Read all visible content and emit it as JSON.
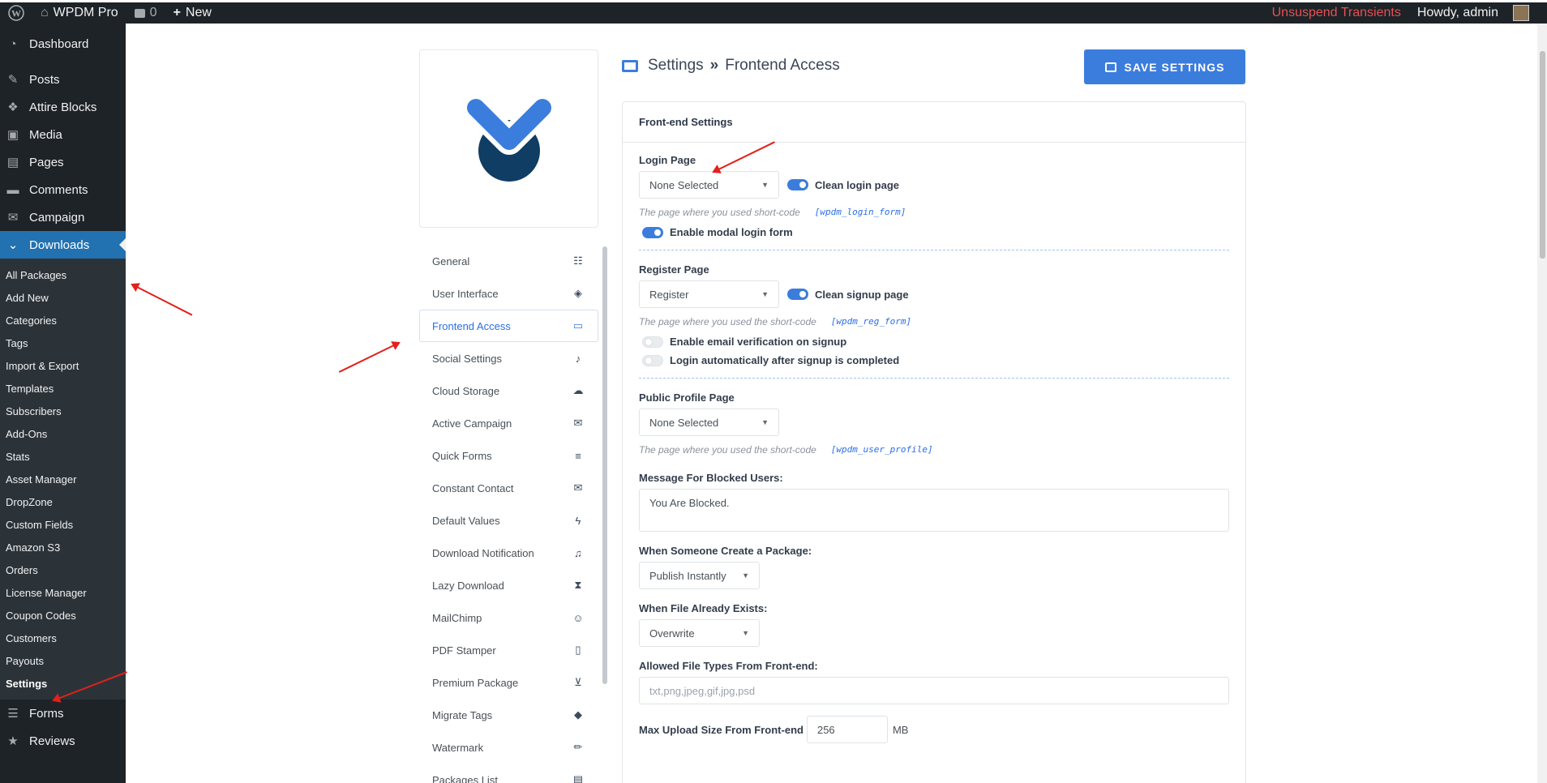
{
  "admin_bar": {
    "site_name": "WPDM Pro",
    "comments_count": "0",
    "new_label": "New",
    "unsuspend": "Unsuspend Transients",
    "howdy": "Howdy, admin"
  },
  "sidebar": {
    "top_items": [
      {
        "label": "Dashboard",
        "icon": "dashboard-icon"
      },
      {
        "label": "Posts",
        "icon": "pin-icon"
      },
      {
        "label": "Attire Blocks",
        "icon": "blocks-icon"
      },
      {
        "label": "Media",
        "icon": "media-icon"
      },
      {
        "label": "Pages",
        "icon": "pages-icon"
      },
      {
        "label": "Comments",
        "icon": "comment-icon"
      },
      {
        "label": "Campaign",
        "icon": "mail-icon"
      }
    ],
    "active_item": "Downloads",
    "sub_items": [
      "All Packages",
      "Add New",
      "Categories",
      "Tags",
      "Import & Export",
      "Templates",
      "Subscribers",
      "Add-Ons",
      "Stats",
      "Asset Manager",
      "DropZone",
      "Custom Fields",
      "Amazon S3",
      "Orders",
      "License Manager",
      "Coupon Codes",
      "Customers",
      "Payouts",
      "Settings"
    ],
    "bottom_items": [
      {
        "label": "Forms",
        "icon": "forms-icon"
      },
      {
        "label": "Reviews",
        "icon": "star-icon"
      }
    ]
  },
  "settings_nav": [
    {
      "label": "General",
      "icon": "sliders-icon"
    },
    {
      "label": "User Interface",
      "icon": "paint-bucket-icon"
    },
    {
      "label": "Frontend Access",
      "icon": "desktop-icon"
    },
    {
      "label": "Social Settings",
      "icon": "twitter-icon"
    },
    {
      "label": "Cloud Storage",
      "icon": "cloud-upload-icon"
    },
    {
      "label": "Active Campaign",
      "icon": "envelope-icon"
    },
    {
      "label": "Quick Forms",
      "icon": "bars-icon"
    },
    {
      "label": "Constant Contact",
      "icon": "envelope-icon"
    },
    {
      "label": "Default Values",
      "icon": "bolt-icon"
    },
    {
      "label": "Download Notification",
      "icon": "bell-icon"
    },
    {
      "label": "Lazy Download",
      "icon": "hourglass-icon"
    },
    {
      "label": "MailChimp",
      "icon": "mailchimp-icon"
    },
    {
      "label": "PDF Stamper",
      "icon": "pdf-icon"
    },
    {
      "label": "Premium Package",
      "icon": "basket-icon"
    },
    {
      "label": "Migrate Tags",
      "icon": "tags-icon"
    },
    {
      "label": "Watermark",
      "icon": "pen-icon"
    },
    {
      "label": "Packages List",
      "icon": "list-icon"
    }
  ],
  "heading": {
    "settings": "Settings",
    "separator": "»",
    "section": "Frontend Access"
  },
  "save_button": "SAVE SETTINGS",
  "panel": {
    "title": "Front-end Settings",
    "login": {
      "label": "Login Page",
      "select": "None Selected",
      "clean_toggle": "Clean login page",
      "help": "The page where you used short-code",
      "code": "[wpdm_login_form]",
      "modal_toggle": "Enable modal login form"
    },
    "register": {
      "label": "Register Page",
      "select": "Register",
      "clean_toggle": "Clean signup page",
      "help": "The page where you used the short-code",
      "code": "[wpdm_reg_form]",
      "email_verification": "Enable email verification on signup",
      "auto_login": "Login automatically after signup is completed"
    },
    "profile": {
      "label": "Public Profile Page",
      "select": "None Selected",
      "help": "The page where you used the short-code",
      "code": "[wpdm_user_profile]"
    },
    "blocked": {
      "label": "Message For Blocked Users:",
      "value": "You Are Blocked."
    },
    "create": {
      "label": "When Someone Create a Package:",
      "select": "Publish Instantly"
    },
    "exists": {
      "label": "When File Already Exists:",
      "select": "Overwrite"
    },
    "file_types": {
      "label": "Allowed File Types From Front-end:",
      "placeholder": "txt,png,jpeg,gif,jpg,psd"
    },
    "max_upload": {
      "label": "Max Upload Size From Front-end",
      "value": "256",
      "unit": "MB"
    }
  },
  "colors": {
    "accent": "#3b7ddd",
    "sidebar": "#1d2327",
    "annotation_arrow": "#e3201b"
  }
}
